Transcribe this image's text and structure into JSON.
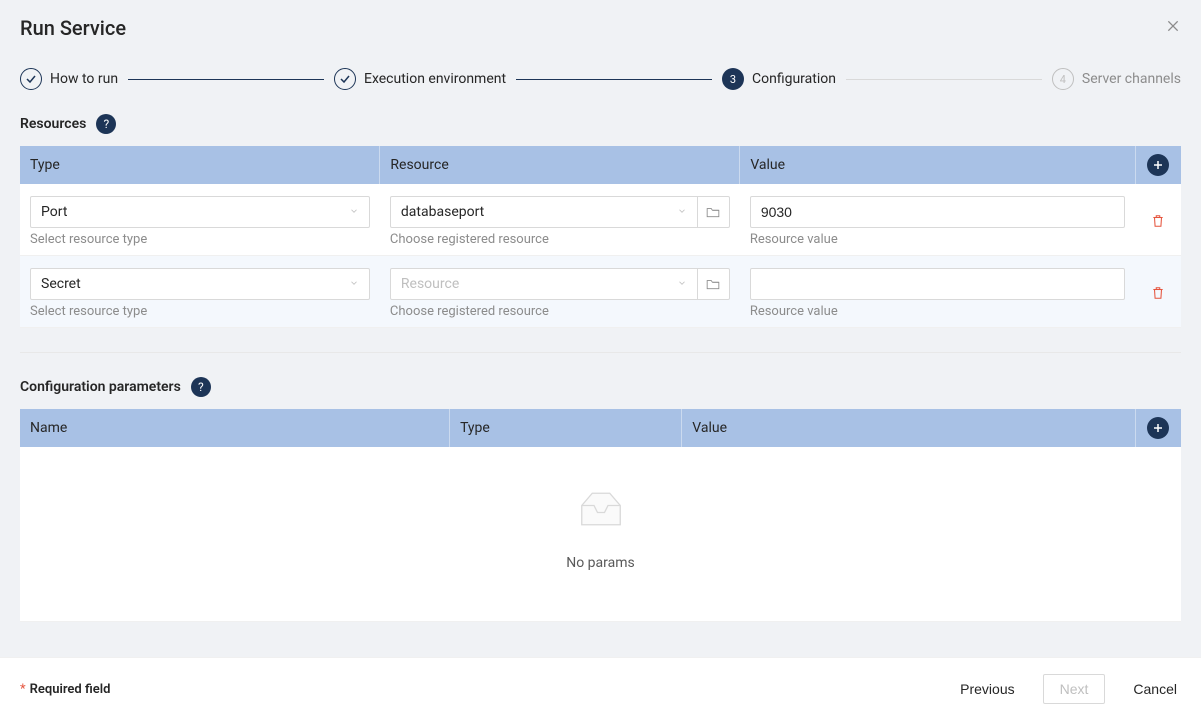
{
  "modal": {
    "title": "Run Service"
  },
  "steps": [
    {
      "label": "How to run",
      "state": "done"
    },
    {
      "label": "Execution environment",
      "state": "done"
    },
    {
      "label": "Configuration",
      "state": "current",
      "number": "3"
    },
    {
      "label": "Server channels",
      "state": "pending",
      "number": "4"
    }
  ],
  "resources": {
    "title": "Resources",
    "columns": {
      "type": "Type",
      "resource": "Resource",
      "value": "Value"
    },
    "hints": {
      "type": "Select resource type",
      "resource": "Choose registered resource",
      "value": "Resource value"
    },
    "resource_placeholder": "Resource",
    "rows": [
      {
        "type": "Port",
        "resource": "databaseport",
        "value": "9030"
      },
      {
        "type": "Secret",
        "resource": "",
        "value": ""
      }
    ]
  },
  "config_params": {
    "title": "Configuration parameters",
    "columns": {
      "name": "Name",
      "type": "Type",
      "value": "Value"
    },
    "empty": "No params"
  },
  "footer": {
    "required": "Required field",
    "previous": "Previous",
    "next": "Next",
    "cancel": "Cancel"
  }
}
